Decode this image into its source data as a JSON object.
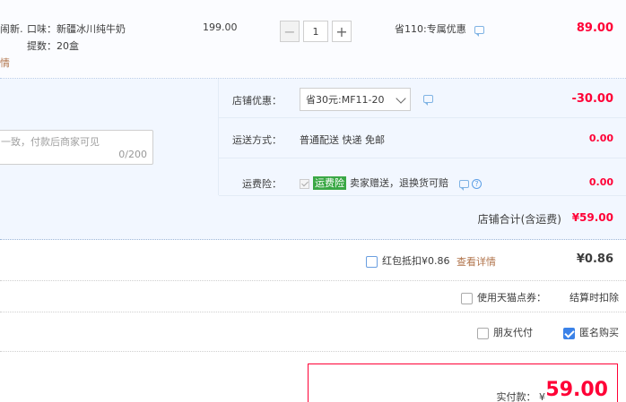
{
  "item": {
    "name_partial": "闹新…",
    "detail_link_partial": "情",
    "attr_flavor": "口味：新疆冰川纯牛奶",
    "attr_count": "提数：20盒",
    "unit_price": "199.00",
    "quantity": "1",
    "minus": "−",
    "plus": "+",
    "discount_text": "省110:专属优惠",
    "subtotal": "89.00"
  },
  "store": {
    "message_placeholder": "一致，付款后商家可见",
    "message_count": "0/200",
    "coupon_label": "店铺优惠：",
    "coupon_selected": "省30元:MF11-20",
    "coupon_amount": "-30.00",
    "shipping_label": "运送方式：",
    "shipping_value": "普通配送 快递 免邮",
    "shipping_amount": "0.00",
    "insurance_label": "运费险：",
    "insurance_tag": "运费险",
    "insurance_text": "卖家赠送，退换货可赔",
    "insurance_help": "?",
    "insurance_amount": "0.00",
    "total_label": "店铺合计(含运费)",
    "total_value": "¥59.00"
  },
  "redpacket": {
    "label": "红包抵扣¥0.86",
    "details_link": "查看详情",
    "amount": "¥0.86"
  },
  "points": {
    "label": "使用天猫点券：",
    "note": "结算时扣除"
  },
  "options": {
    "friend_pay": "朋友代付",
    "anonymous": "匿名购买"
  },
  "payment": {
    "label": "实付款：",
    "currency": "¥",
    "value": "59.00"
  },
  "colors": {
    "price_red": "#ff0036",
    "accent_blue": "#3b82e8",
    "link_brown": "#b0734a"
  }
}
